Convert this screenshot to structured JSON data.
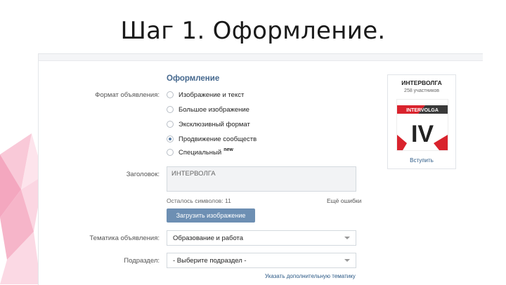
{
  "slide": {
    "title": "Шаг 1. Оформление."
  },
  "form": {
    "section_title": "Оформление",
    "format_label": "Формат объявления:",
    "format_options": [
      {
        "label": "Изображение и текст",
        "selected": false
      },
      {
        "label": "Большое изображение",
        "selected": false
      },
      {
        "label": "Эксклюзивный формат",
        "selected": false
      },
      {
        "label": "Продвижение сообществ",
        "selected": true
      },
      {
        "label": "Специальный",
        "selected": false,
        "badge": "new"
      }
    ],
    "headline_label": "Заголовок:",
    "headline_value": "ИНТЕРВОЛГА",
    "chars_left": "Осталось символов: 11",
    "extra_link": "Ещё ошибки",
    "upload_button": "Загрузить изображение",
    "theme_label": "Тематика объявления:",
    "theme_value": "Образование и работа",
    "subsection_label": "Подраздел:",
    "subsection_value": "- Выберите подраздел -",
    "theme_link": "Указать дополнительную тематику"
  },
  "preview": {
    "title": "ИНТЕРВОЛГА",
    "subtitle": "258 участников",
    "logo_text": "INTERVOLGA",
    "logo_letters": "IV",
    "join_label": "Вступить"
  },
  "colors": {
    "accent": "#45688e",
    "button": "#6d8fb3",
    "brand_red": "#d9232d",
    "decoration": "#f7b8cc"
  }
}
